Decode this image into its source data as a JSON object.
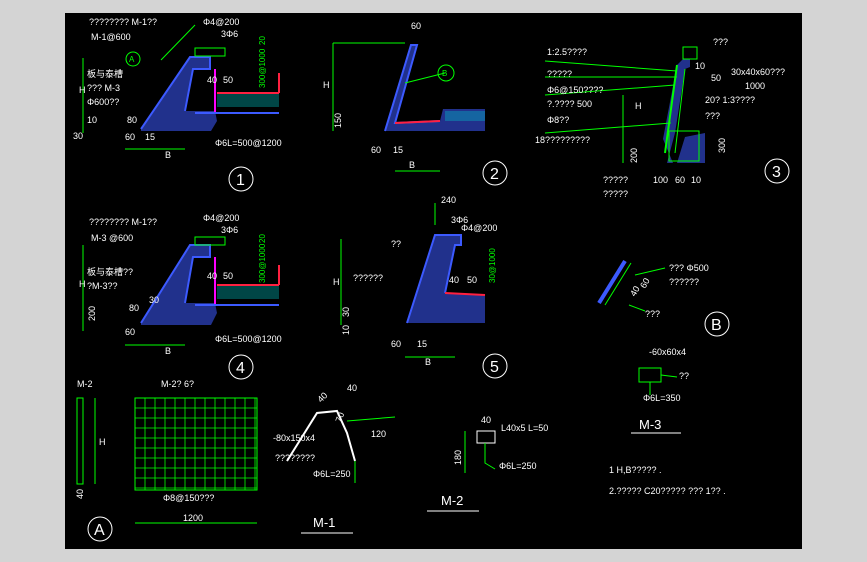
{
  "colors": {
    "background": "#000000",
    "frame": "#d4d4d4",
    "concrete": "#3c5aff",
    "dim": "#00ff00",
    "text": "#ffffff",
    "member": "#ff00ff",
    "rebar": "#ff2040",
    "insulation": "#00c8c8"
  },
  "detail1": {
    "anno_top": "????????  M-1??",
    "anno_m": "M-1@600",
    "bubble": "A",
    "anno_a": "板与泰槽",
    "anno_b": "??? M-3",
    "anno_c": "Φ600??",
    "rebar_top": "Φ4@200",
    "rebar_top2": "3Φ6",
    "dim_20": "20",
    "dim_300": "300@1000",
    "dim_40": "40",
    "dim_50": "50",
    "dim_h": "H",
    "dim_10": "10",
    "dim_80": "80",
    "dim_30": "30",
    "dim_60": "60",
    "dim_15": "15",
    "dim_b": "B",
    "rebar_bot": "Φ6L=500@1200",
    "num": "1"
  },
  "detail2": {
    "dim_60": "60",
    "dim_h": "H",
    "dim_150": "150",
    "bubble": "B",
    "dim_60b": "60",
    "dim_15": "15",
    "dim_b": "B",
    "num": "2"
  },
  "detail3": {
    "l1": "1:2.5????",
    "l2": "?????",
    "l3": "Φ6@150????",
    "l4": "?.???? 500",
    "l5": "Φ8??",
    "l6": "18?????????",
    "t1": "???",
    "t2": "30x40x60???",
    "t3": "1000",
    "t4": "20? 1:3????",
    "t5": "???",
    "d10": "10",
    "d50": "50",
    "dh": "H",
    "d200": "200",
    "d300": "300",
    "d100": "100",
    "d60": "60",
    "d10b": "10",
    "b1": "?????",
    "b2": "?????",
    "num": "3"
  },
  "detail4": {
    "anno_top": "????????  M-1??",
    "anno_m": "M-3 @600",
    "anno_a": "板与泰槽??",
    "anno_b": "?M-3??",
    "rebar_top": "Φ4@200",
    "rebar_top2": "3Φ6",
    "dim_20": "20",
    "dim_300": "300@1000",
    "dim_40": "40",
    "dim_50": "50",
    "dim_h": "H",
    "dim_200": "200",
    "dim_80": "80",
    "dim_30": "30",
    "dim_60": "60",
    "dim_b": "B",
    "rebar_bot": "Φ6L=500@1200",
    "num": "4"
  },
  "detail5": {
    "dim_240": "240",
    "rebar1": "3Φ6",
    "rebar2": "Φ4@200",
    "l1": "??",
    "l2": "??????",
    "dim_h": "H",
    "dim_40": "40",
    "dim_50": "50",
    "dim_30": "30@1000",
    "dim_30b": "30",
    "dim_10": "10",
    "dim_60": "60",
    "dim_15": "15",
    "dim_b": "B",
    "num": "5"
  },
  "detailB": {
    "l1": "???  Φ500",
    "l2": "??????",
    "l3": "???",
    "d40": "40",
    "d60": "60",
    "bubble": "B"
  },
  "m2_left": {
    "title": "M-2",
    "dim_h": "H",
    "dim_40": "40"
  },
  "mesh": {
    "title": "M-2? 6?",
    "rebar": "Φ8@150???",
    "width": "1200",
    "bubble": "A"
  },
  "m1": {
    "d40": "40",
    "d40b": "40",
    "d70": "70",
    "d120": "120",
    "l1": "-80x150x4",
    "l2": "????????",
    "l3": "Φ6L=250",
    "title": "M-1"
  },
  "m2": {
    "d40": "40",
    "l1": "L40x5  L=50",
    "d180": "180",
    "l2": "Φ6L=250",
    "title": "M-2"
  },
  "m3": {
    "l1": "-60x60x4",
    "l2": "??",
    "l3": "Φ6L=350",
    "title": "M-3"
  },
  "notes": {
    "n1": "1  H,B?????  .",
    "n2": "2.?????  C20?????   ???  1??  ."
  }
}
